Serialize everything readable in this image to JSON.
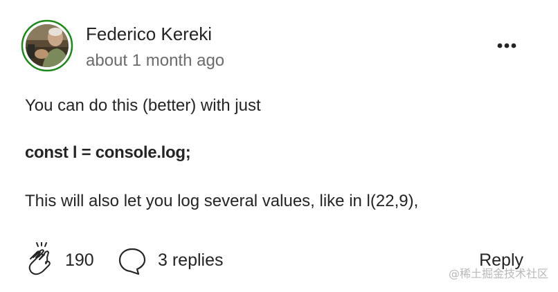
{
  "comment": {
    "author": "Federico Kereki",
    "time": "about 1 month ago",
    "paragraphs": [
      "You can do this (better) with just",
      "const l = console.log;",
      "This will also let you log several values, like in l(22,9),"
    ],
    "claps": "190",
    "replies": "3 replies",
    "reply_label": "Reply",
    "more_icon": "more-horizontal-icon",
    "clap_icon": "clap-icon",
    "reply_icon": "speech-bubble-icon"
  },
  "watermark": "@稀土掘金技术社区",
  "colors": {
    "text": "#242424",
    "secondary": "#6b6b6b",
    "avatar_ring": "#1a8917",
    "watermark": "#b8b8b8"
  }
}
